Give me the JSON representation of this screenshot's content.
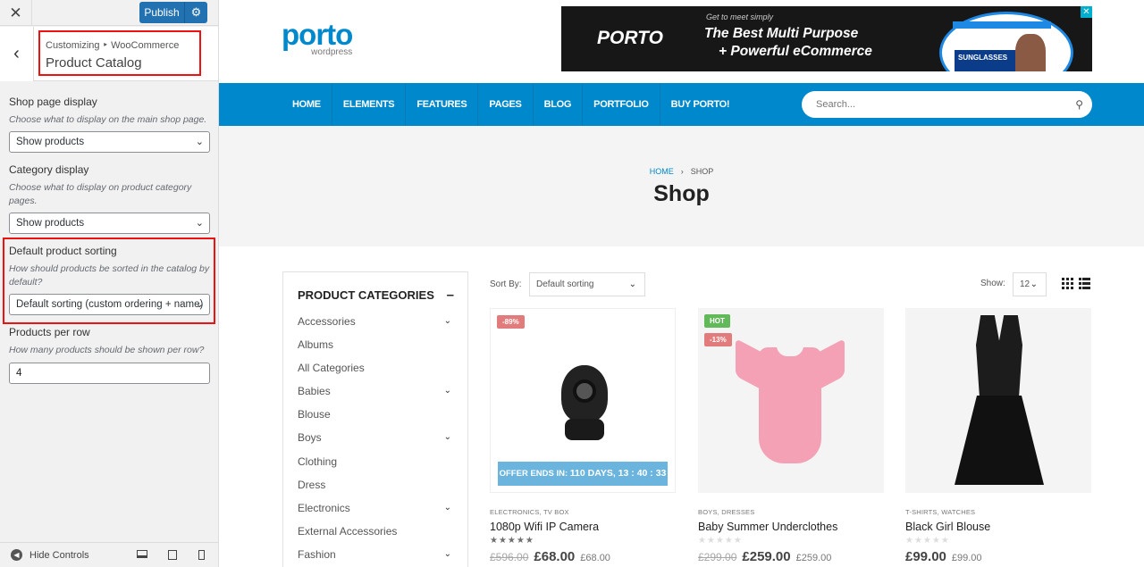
{
  "customizer": {
    "publish_label": "Publish",
    "breadcrumb": "Customizing ‣ WooCommerce",
    "section_title": "Product Catalog",
    "shop_page_display": {
      "label": "Shop page display",
      "description": "Choose what to display on the main shop page.",
      "value": "Show products"
    },
    "category_display": {
      "label": "Category display",
      "description": "Choose what to display on product category pages.",
      "value": "Show products"
    },
    "default_sorting": {
      "label": "Default product sorting",
      "description": "How should products be sorted in the catalog by default?",
      "value": "Default sorting (custom ordering + name)"
    },
    "products_per_row": {
      "label": "Products per row",
      "description": "How many products should be shown per row?",
      "value": "4"
    },
    "hide_controls": "Hide Controls"
  },
  "site": {
    "logo": "porto",
    "logo_sub": "wordpress",
    "banner": {
      "brand": "PORTO",
      "small": "Get to meet simply",
      "line1": "The Best Multi Purpose",
      "line2": "+ Powerful eCommerce",
      "bubble_text": "SUNGLASSES"
    },
    "menu": [
      "HOME",
      "ELEMENTS",
      "FEATURES",
      "PAGES",
      "BLOG",
      "PORTFOLIO",
      "BUY PORTO!"
    ],
    "search_placeholder": "Search...",
    "breadcrumb": {
      "home": "HOME",
      "sep": "›",
      "current": "SHOP"
    },
    "page_title": "Shop",
    "categories_title": "PRODUCT CATEGORIES",
    "categories": [
      "Accessories",
      "Albums",
      "All Categories",
      "Babies",
      "Blouse",
      "Boys",
      "Clothing",
      "Dress",
      "Electronics",
      "External Accessories",
      "Fashion"
    ],
    "sort_label": "Sort By:",
    "sort_value": "Default sorting",
    "show_label": "Show:",
    "show_value": "12",
    "products": [
      {
        "label": "-89%",
        "offer_text": "OFFER ENDS IN:",
        "countdown": "110 DAYS, 13 : 40 : 33",
        "cats": "ELECTRONICS, TV BOX",
        "name": "1080p Wifi IP Camera",
        "rating": 5,
        "old_price": "£596.00",
        "price": "£68.00",
        "alt_price": "£68.00"
      },
      {
        "label_hot": "HOT",
        "label": "-13%",
        "cats": "BOYS, DRESSES",
        "name": "Baby Summer Underclothes",
        "rating": 0,
        "old_price": "£299.00",
        "price": "£259.00",
        "alt_price": "£259.00"
      },
      {
        "cats": "T-SHIRTS, WATCHES",
        "name": "Black Girl Blouse",
        "rating": 0,
        "price": "£99.00",
        "alt_price": "£99.00"
      }
    ]
  }
}
